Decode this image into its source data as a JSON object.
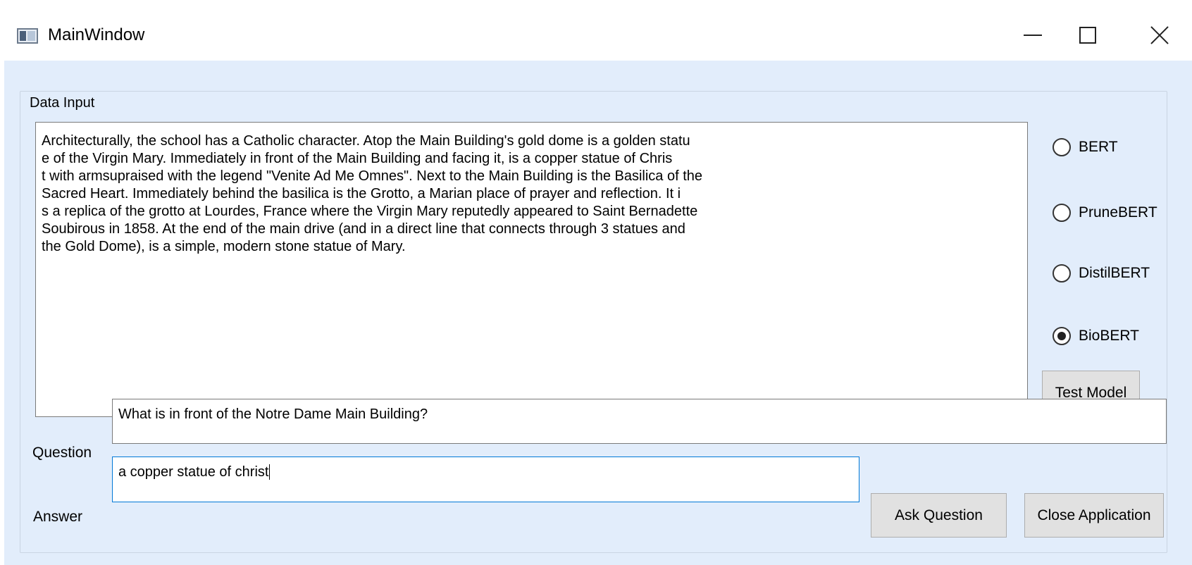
{
  "window": {
    "title": "MainWindow",
    "icon": "app-window-icon"
  },
  "group": {
    "title": "Data Input"
  },
  "data_input": {
    "text": "Architecturally, the school has a Catholic character. Atop the Main Building's gold dome is a golden statu\ne of the Virgin Mary. Immediately in front of the Main Building and facing it, is a copper statue of Chris\nt with armsupraised with the legend \"Venite Ad Me Omnes\". Next to the Main Building is the Basilica of the\nSacred Heart. Immediately behind the basilica is the Grotto, a Marian place of prayer and reflection. It i\ns a replica of the grotto at Lourdes, France where the Virgin Mary reputedly appeared to Saint Bernadette\nSoubirous in 1858. At the end of the main drive (and in a direct line that connects through 3 statues and\nthe Gold Dome), is a simple, modern stone statue of Mary."
  },
  "models": [
    {
      "label": "BERT",
      "checked": false
    },
    {
      "label": "PruneBERT",
      "checked": false
    },
    {
      "label": "DistilBERT",
      "checked": false
    },
    {
      "label": "BioBERT",
      "checked": true
    }
  ],
  "buttons": {
    "test_model": "Test Model",
    "ask_question": "Ask Question",
    "close_application": "Close Application"
  },
  "question": {
    "label": "Question",
    "value": "What is in front of the Notre Dame Main Building?"
  },
  "answer": {
    "label": "Answer",
    "value": "a copper statue of christ"
  }
}
